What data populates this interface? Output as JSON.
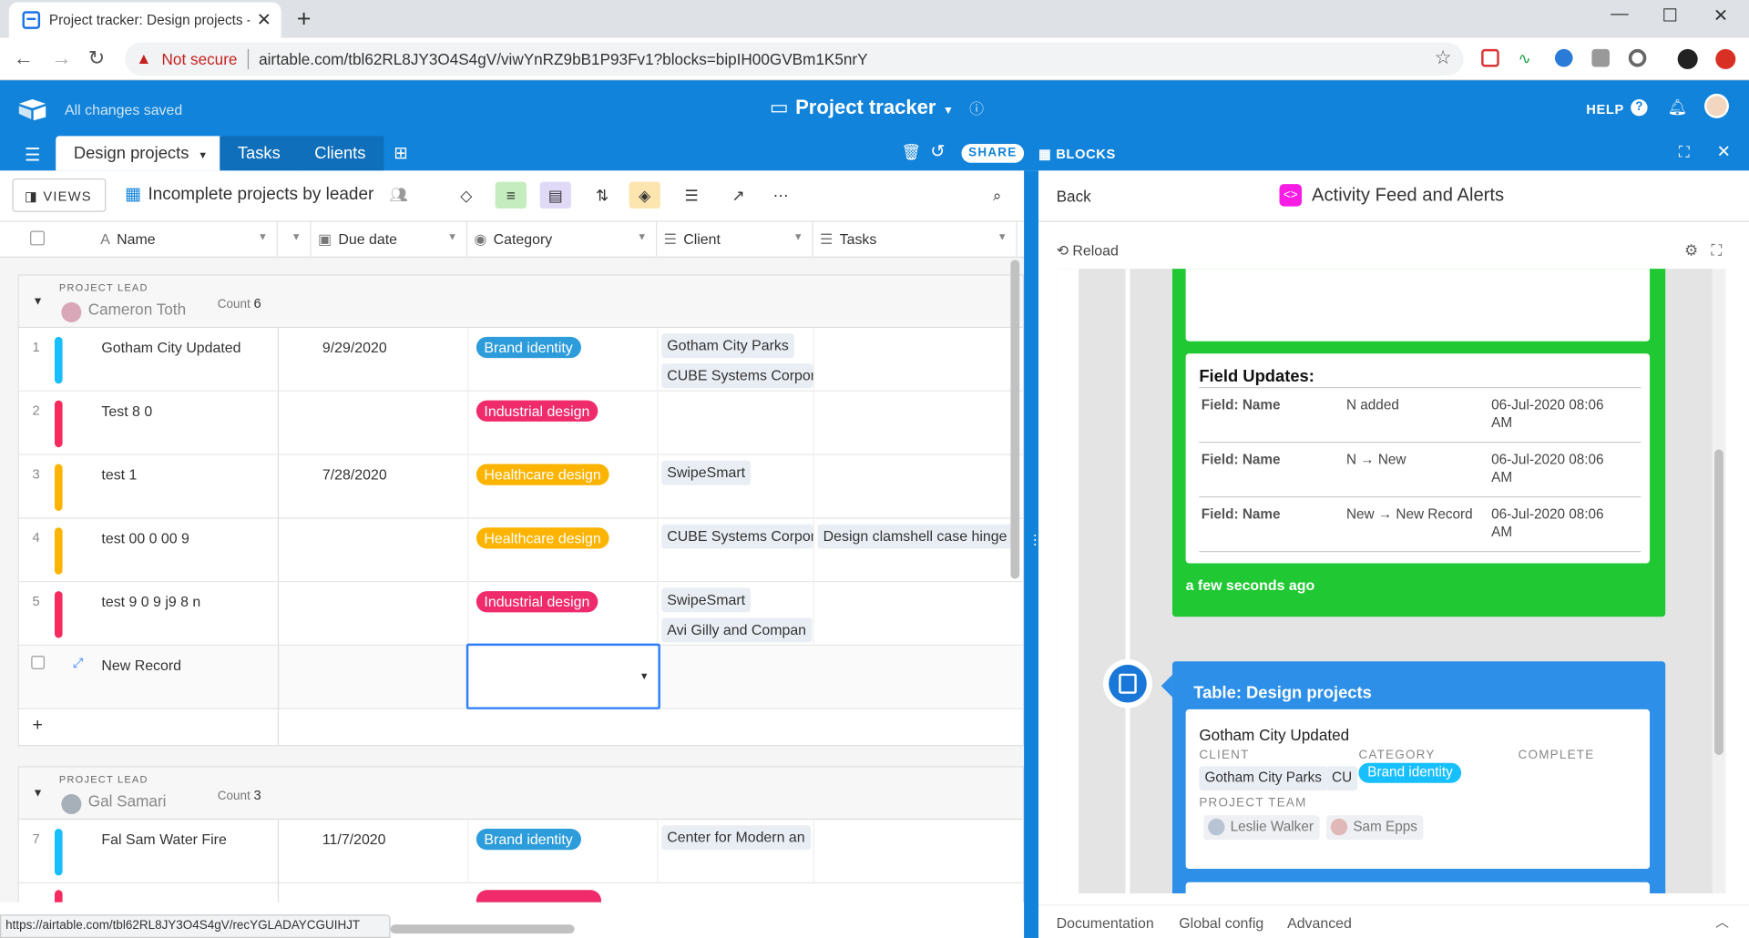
{
  "browser": {
    "tab_title": "Project tracker: Design projects -",
    "security_label": "Not secure",
    "url": "airtable.com/tbl62RL8JY3O4S4gV/viwYnRZ9bB1P93Fv1?blocks=bipIH00GVBm1K5nrY",
    "status_url": "https://airtable.com/tbl62RL8JY3O4S4gV/recYGLADAYCGUIHJT"
  },
  "app": {
    "saved_status": "All changes saved",
    "base_title": "Project tracker",
    "help_label": "HELP",
    "tables": [
      "Design projects",
      "Tasks",
      "Clients"
    ],
    "share_label": "SHARE",
    "blocks_label": "BLOCKS"
  },
  "toolbar": {
    "views_label": "VIEWS",
    "view_name": "Incomplete projects by leader"
  },
  "columns": [
    "Name",
    "Due date",
    "Category",
    "Client",
    "Tasks"
  ],
  "colors": {
    "header_blue": "#1283da",
    "brand_identity": "#2d9cdb",
    "industrial": "#ef2b6c",
    "healthcare": "#fcb400",
    "feed_green": "#20c933",
    "feed_blue": "#2d8fe8"
  },
  "groups": [
    {
      "label": "PROJECT LEAD",
      "leader": "Cameron Toth",
      "count_label": "Count",
      "count": "6",
      "rows": [
        {
          "num": "1",
          "name": "Gotham City Updated",
          "due": "9/29/2020",
          "category": "Brand identity",
          "cat_color": "#2d9cdb",
          "bar_color": "#18bfff",
          "clients": [
            "Gotham City Parks",
            "CUBE Systems Corpor"
          ],
          "tasks": []
        },
        {
          "num": "2",
          "name": "Test 8 0",
          "due": "",
          "category": "Industrial design",
          "cat_color": "#ef2b6c",
          "bar_color": "#f82b60",
          "clients": [],
          "tasks": []
        },
        {
          "num": "3",
          "name": "test 1",
          "due": "7/28/2020",
          "category": "Healthcare design",
          "cat_color": "#fcb400",
          "bar_color": "#fcb400",
          "clients": [
            "SwipeSmart"
          ],
          "tasks": []
        },
        {
          "num": "4",
          "name": "test  00 0 00  9",
          "due": "",
          "category": "Healthcare design",
          "cat_color": "#fcb400",
          "bar_color": "#fcb400",
          "clients": [
            "CUBE Systems Corpor"
          ],
          "tasks": [
            "Design clamshell case hinge"
          ]
        },
        {
          "num": "5",
          "name": "test 9  0 9 j9 8 n",
          "due": "",
          "category": "Industrial design",
          "cat_color": "#ef2b6c",
          "bar_color": "#f82b60",
          "clients": [
            "SwipeSmart",
            "Avi Gilly and Compan"
          ],
          "tasks": []
        }
      ],
      "new_record": "New Record"
    },
    {
      "label": "PROJECT LEAD",
      "leader": "Gal Samari",
      "count_label": "Count",
      "count": "3",
      "rows": [
        {
          "num": "7",
          "name": "Fal Sam Water Fire",
          "due": "11/7/2020",
          "category": "Brand identity",
          "cat_color": "#2d9cdb",
          "bar_color": "#18bfff",
          "clients": [
            "Center for Modern an"
          ],
          "tasks": []
        }
      ]
    }
  ],
  "block": {
    "back_label": "Back",
    "title": "Activity Feed and Alerts",
    "reload_label": "Reload",
    "field_updates_title": "Field Updates:",
    "field_updates": [
      {
        "field": "Field: Name",
        "change": "N added",
        "time": "06-Jul-2020 08:06",
        "ampm": "AM"
      },
      {
        "field": "Field: Name",
        "change": "N → New",
        "time": "06-Jul-2020 08:06",
        "ampm": "AM"
      },
      {
        "field": "Field: Name",
        "change": "New → New Record",
        "time": "06-Jul-2020 08:06",
        "ampm": "AM"
      }
    ],
    "relative_time": "a few seconds ago",
    "table_title": "Table: Design projects",
    "record": {
      "name": "Gotham City Updated",
      "client_label": "CLIENT",
      "category_label": "CATEGORY",
      "complete_label": "COMPLETE",
      "clients": [
        "Gotham City Parks",
        "CU"
      ],
      "category": "Brand identity",
      "team_label": "PROJECT TEAM",
      "team": [
        "Leslie Walker",
        "Sam Epps"
      ]
    },
    "footer": [
      "Documentation",
      "Global config",
      "Advanced"
    ]
  }
}
